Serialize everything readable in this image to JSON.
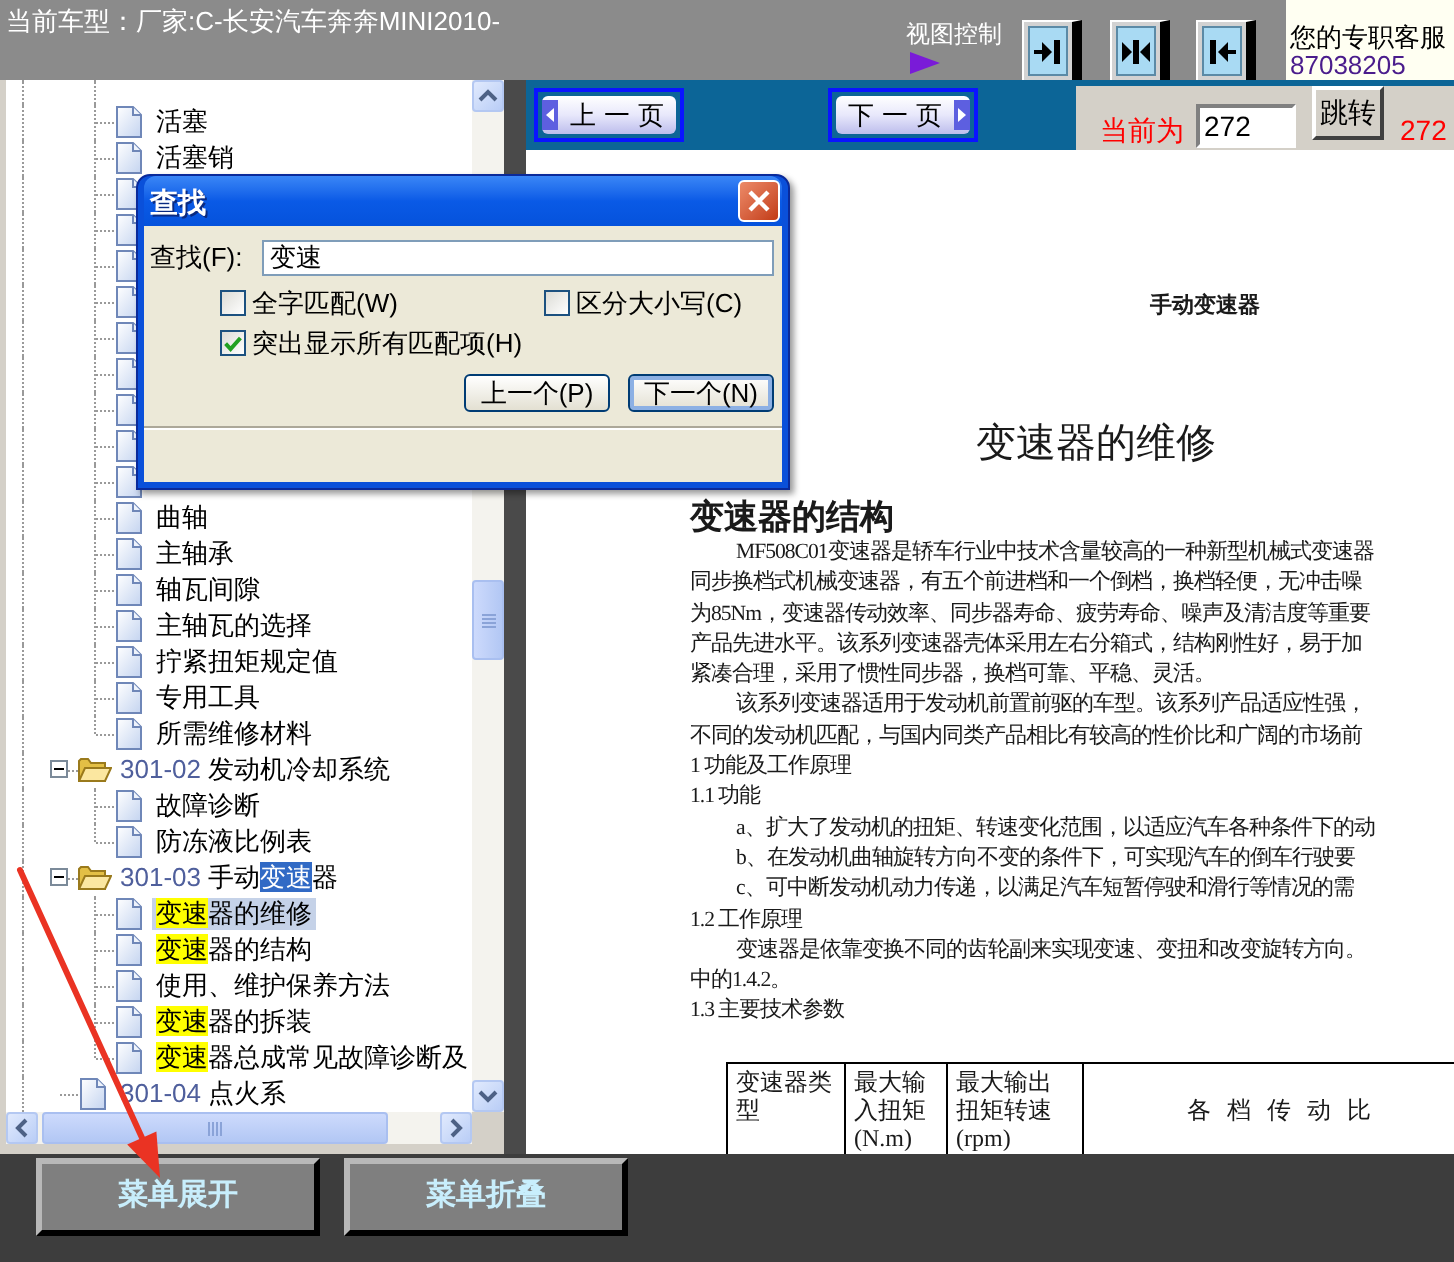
{
  "top_bar": {
    "vehicle": "当前车型：厂家:C-长安汽车奔奔MINI2010-",
    "view_control": "视图控制",
    "service_label": "您的专职客服",
    "service_phone": "87038205"
  },
  "tree": {
    "items": [
      {
        "kind": "offscreen",
        "children": [
          {
            "kind": "page",
            "selected": false,
            "segments": [
              {
                "text": "活塞",
                "highlighted": false
              }
            ]
          },
          {
            "kind": "page",
            "selected": false,
            "segments": [
              {
                "text": "活塞销",
                "highlighted": false
              }
            ]
          },
          {
            "kind": "page"
          },
          {
            "kind": "page"
          },
          {
            "kind": "page"
          },
          {
            "kind": "page"
          },
          {
            "kind": "page"
          },
          {
            "kind": "page"
          },
          {
            "kind": "page"
          },
          {
            "kind": "page"
          },
          {
            "kind": "page"
          },
          {
            "kind": "page",
            "selected": false,
            "segments": [
              {
                "text": "曲轴",
                "highlighted": false
              }
            ]
          },
          {
            "kind": "page",
            "selected": false,
            "segments": [
              {
                "text": "主轴承",
                "highlighted": false
              }
            ]
          },
          {
            "kind": "page",
            "selected": false,
            "segments": [
              {
                "text": "轴瓦间隙",
                "highlighted": false
              }
            ]
          },
          {
            "kind": "page",
            "selected": false,
            "segments": [
              {
                "text": "主轴瓦的选择",
                "highlighted": false
              }
            ]
          },
          {
            "kind": "page",
            "selected": false,
            "segments": [
              {
                "text": "拧紧扭矩规定值",
                "highlighted": false
              }
            ]
          },
          {
            "kind": "page",
            "selected": false,
            "segments": [
              {
                "text": "专用工具",
                "highlighted": false
              }
            ]
          },
          {
            "kind": "page",
            "selected": false,
            "segments": [
              {
                "text": "所需维修材料",
                "highlighted": false
              }
            ]
          }
        ]
      },
      {
        "kind": "folder",
        "code": "301-02",
        "expanded": true,
        "selected": false,
        "segments": [
          {
            "text": "发动机冷却系统",
            "highlighted": false
          }
        ],
        "children": [
          {
            "kind": "page",
            "selected": false,
            "segments": [
              {
                "text": "故障诊断",
                "highlighted": false
              }
            ]
          },
          {
            "kind": "page",
            "selected": false,
            "segments": [
              {
                "text": "防冻液比例表",
                "highlighted": false
              }
            ]
          }
        ]
      },
      {
        "kind": "folder",
        "code": "301-03",
        "expanded": true,
        "selected": false,
        "segments": [
          {
            "text": "手动",
            "highlighted": false
          },
          {
            "text": "变速",
            "highlighted": true,
            "current": true
          },
          {
            "text": "器",
            "highlighted": false
          }
        ],
        "children": [
          {
            "kind": "page",
            "selected": true,
            "segments": [
              {
                "text": "变速",
                "highlighted": true
              },
              {
                "text": "器的维修",
                "highlighted": false
              }
            ]
          },
          {
            "kind": "page",
            "selected": false,
            "segments": [
              {
                "text": "变速",
                "highlighted": true
              },
              {
                "text": "器的结构",
                "highlighted": false
              }
            ]
          },
          {
            "kind": "page",
            "selected": false,
            "segments": [
              {
                "text": "使用、维护保养方法",
                "highlighted": false
              }
            ]
          },
          {
            "kind": "page",
            "selected": false,
            "segments": [
              {
                "text": "变速",
                "highlighted": true
              },
              {
                "text": "器的拆装",
                "highlighted": false
              }
            ]
          },
          {
            "kind": "page",
            "selected": false,
            "segments": [
              {
                "text": "变速",
                "highlighted": true
              },
              {
                "text": "器总成常见故障诊断及",
                "highlighted": false
              }
            ]
          }
        ]
      },
      {
        "kind": "page",
        "code": "301-04",
        "selected": false,
        "segments": [
          {
            "text": "点火系",
            "highlighted": false
          }
        ]
      }
    ]
  },
  "find_dialog": {
    "title": "查找",
    "find_label": "查找(F):",
    "query": "变速",
    "options": [
      {
        "label": "全字匹配(W)",
        "checked": false
      },
      {
        "label": "区分大小写(C)",
        "checked": false
      },
      {
        "label": "突出显示所有匹配项(H)",
        "checked": true
      }
    ],
    "buttons": [
      {
        "label": "上一个(P)",
        "focused": false
      },
      {
        "label": "下一个(N)",
        "focused": true
      }
    ]
  },
  "pager": {
    "buttons": [
      {
        "kind": "prev",
        "label": "上一页"
      },
      {
        "kind": "next",
        "label": "下一页"
      }
    ],
    "current_label": "当前为",
    "page_value": "272",
    "jump_button": "跳转",
    "total": "272"
  },
  "document": {
    "header": "手动变速器",
    "title": "变速器的维修",
    "section": "变速器的结构",
    "lines": [
      {
        "indent": true,
        "text": "MF508C01变速器是轿车行业中技术含量较高的一种新型机械式变速器"
      },
      {
        "indent": false,
        "text": "同步换档式机械变速器，有五个前进档和一个倒档，换档轻便，无冲击噪"
      },
      {
        "indent": false,
        "text": "为85Nm，变速器传动效率、同步器寿命、疲劳寿命、噪声及清洁度等重要"
      },
      {
        "indent": false,
        "text": "产品先进水平。该系列变速器壳体采用左右分箱式，结构刚性好，易于加"
      },
      {
        "indent": false,
        "text": "紧凑合理，采用了惯性同步器，换档可靠、平稳、灵活。"
      },
      {
        "indent": true,
        "text": "该系列变速器适用于发动机前置前驱的车型。该系列产品适应性强，"
      },
      {
        "indent": false,
        "text": "不同的发动机匹配，与国内同类产品相比有较高的性价比和广阔的市场前"
      },
      {
        "indent": false,
        "text": "1 功能及工作原理"
      },
      {
        "indent": false,
        "text": "1.1 功能"
      },
      {
        "indent": true,
        "text": "a、扩大了发动机的扭矩、转速变化范围，以适应汽车各种条件下的动"
      },
      {
        "indent": true,
        "text": "b、在发动机曲轴旋转方向不变的条件下，可实现汽车的倒车行驶要"
      },
      {
        "indent": true,
        "text": "c、可中断发动机动力传递，以满足汽车短暂停驶和滑行等情况的需"
      },
      {
        "indent": false,
        "text": "1.2 工作原理"
      },
      {
        "indent": true,
        "text": "变速器是依靠变换不同的齿轮副来实现变速、变扭和改变旋转方向。"
      },
      {
        "indent": false,
        "text": "中的1.4.2。"
      },
      {
        "indent": false,
        "text": "1.3 主要技术参数"
      }
    ],
    "table": {
      "columns": [
        "变速器类型",
        "最大输入扭矩(N.m)",
        "最大输出扭矩转速(rpm)",
        "各档传动比"
      ]
    }
  },
  "bottom_buttons": [
    {
      "label": "菜单展开"
    },
    {
      "label": "菜单折叠"
    }
  ]
}
